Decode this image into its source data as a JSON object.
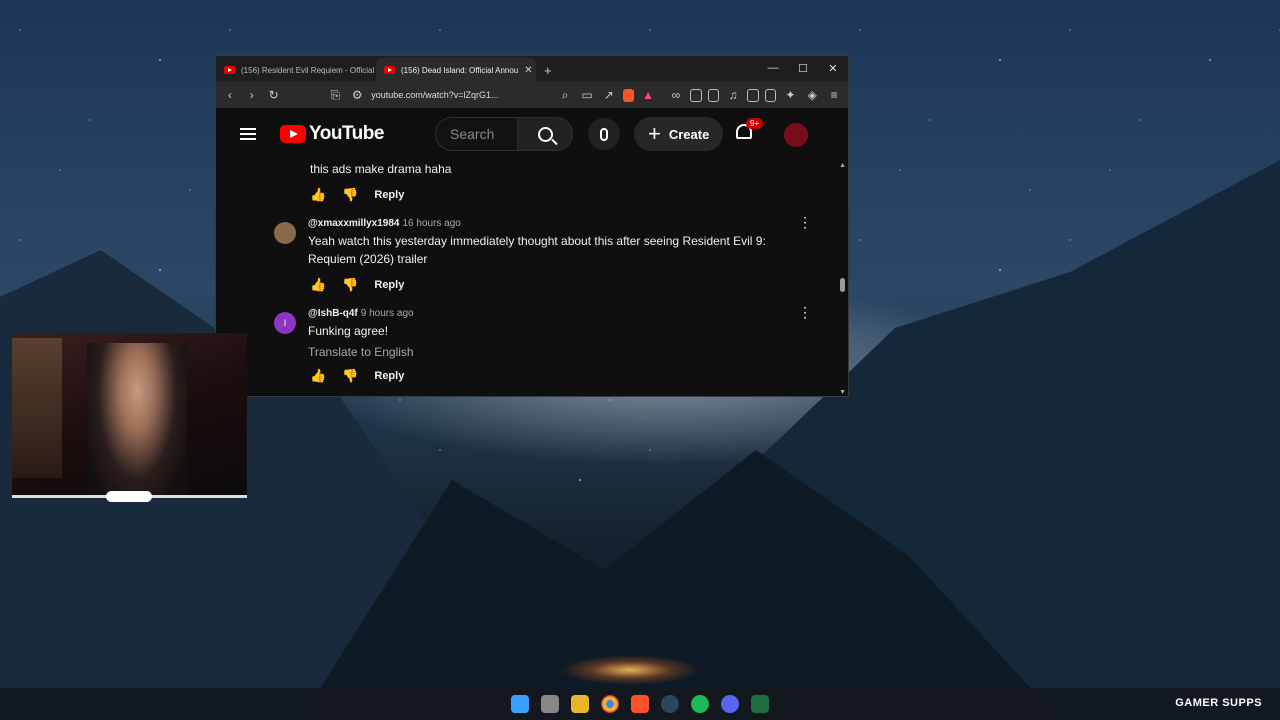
{
  "browser": {
    "tabs": [
      {
        "title": "(156) Resident Evil Requiem - Official",
        "active": false
      },
      {
        "title": "(156) Dead Island: Official Annou",
        "active": true
      }
    ],
    "new_tab": "+",
    "url": "youtube.com/watch?v=lZqrG1...",
    "window_controls": {
      "minimize": "—",
      "maximize": "☐",
      "close": "✕"
    }
  },
  "youtube": {
    "logo_text": "YouTube",
    "search_placeholder": "Search",
    "create_label": "Create",
    "notification_badge": "9+"
  },
  "comments": {
    "partial_top_text": "this ads make drama haha",
    "reply_label": "Reply",
    "items": [
      {
        "author": "@xmaxxmillyx1984",
        "time": "16 hours ago",
        "text": "Yeah watch this yesterday immediately thought about this after seeing Resident Evil 9: Requiem (2026) trailer",
        "avatar_color": "#8a6a4a",
        "avatar_letter": ""
      },
      {
        "author": "@IshB-q4f",
        "time": "9 hours ago",
        "text": "Funking agree!",
        "translate": "Translate to English",
        "avatar_color": "#8e36c4",
        "avatar_letter": "I"
      }
    ]
  },
  "taskbar": {
    "icons": [
      "windows-icon",
      "task-view-icon",
      "file-explorer-icon",
      "chrome-icon",
      "brave-icon",
      "steam-icon",
      "spotify-icon",
      "discord-icon",
      "excel-icon"
    ],
    "colors": {
      "windows": "#3aa0ff",
      "chrome": "#e8b62a",
      "brave": "#fb542b",
      "spotify": "#1db954",
      "discord": "#5865f2",
      "excel": "#1d6f42",
      "steam": "#1b2838"
    }
  },
  "overlay": {
    "brand_text": "GAMER SUPPS"
  }
}
